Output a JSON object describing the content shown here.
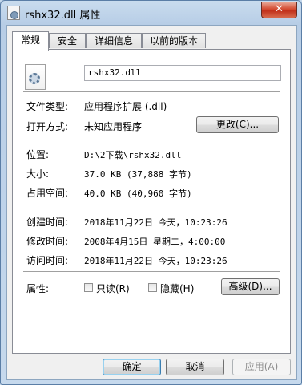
{
  "window": {
    "title": "rshx32.dll 属性",
    "close_glyph": "✕"
  },
  "tabs": [
    {
      "label": "常规",
      "active": true
    },
    {
      "label": "安全",
      "active": false
    },
    {
      "label": "详细信息",
      "active": false
    },
    {
      "label": "以前的版本",
      "active": false
    }
  ],
  "general": {
    "file_name": "rshx32.dll",
    "file_type_label": "文件类型:",
    "file_type_value": "应用程序扩展 (.dll)",
    "opens_with_label": "打开方式:",
    "opens_with_value": "未知应用程序",
    "change_button": "更改(C)...",
    "location_label": "位置:",
    "location_value": "D:\\2下载\\rshx32.dll",
    "size_label": "大小:",
    "size_value": "37.0 KB (37,888 字节)",
    "size_on_disk_label": "占用空间:",
    "size_on_disk_value": "40.0 KB (40,960 字节)",
    "created_label": "创建时间:",
    "created_value": "2018年11月22日 今天，10:23:26",
    "modified_label": "修改时间:",
    "modified_value": "2008年4月15日 星期二，4:00:00",
    "accessed_label": "访问时间:",
    "accessed_value": "2018年11月22日 今天，10:23:26",
    "attributes_label": "属性:",
    "readonly_label": "只读(R)",
    "readonly_checked": false,
    "hidden_label": "隐藏(H)",
    "hidden_checked": false,
    "advanced_button": "高级(D)..."
  },
  "footer": {
    "ok": "确定",
    "cancel": "取消",
    "apply": "应用(A)"
  },
  "colors": {
    "titlebar": "#b7cde6",
    "close_button": "#c1301a",
    "dialog_bg": "#f0f0f0",
    "panel_bg": "#ffffff"
  }
}
